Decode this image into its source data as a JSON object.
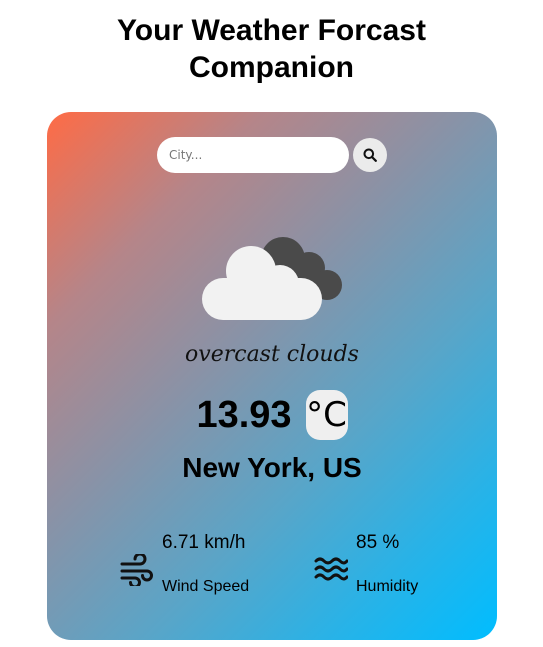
{
  "header": {
    "title_line1": "Your Weather Forcast",
    "title_line2": "Companion"
  },
  "search": {
    "placeholder": "City...",
    "value": "",
    "button_icon": "search-icon"
  },
  "weather": {
    "icon": "overcast-clouds-icon",
    "description": "overcast clouds",
    "temperature": "13.93",
    "unit": "°C",
    "location": "New York, US"
  },
  "details": {
    "wind": {
      "icon": "wind-icon",
      "value": "6.71 km/h",
      "label": "Wind Speed"
    },
    "humidity": {
      "icon": "humidity-waves-icon",
      "value": "85 %",
      "label": "Humidity"
    }
  },
  "colors": {
    "gradient_start": "#ff6b45",
    "gradient_end": "#00bdff",
    "cloud_light": "#f2f2f2",
    "cloud_dark": "#4a4a4a"
  }
}
